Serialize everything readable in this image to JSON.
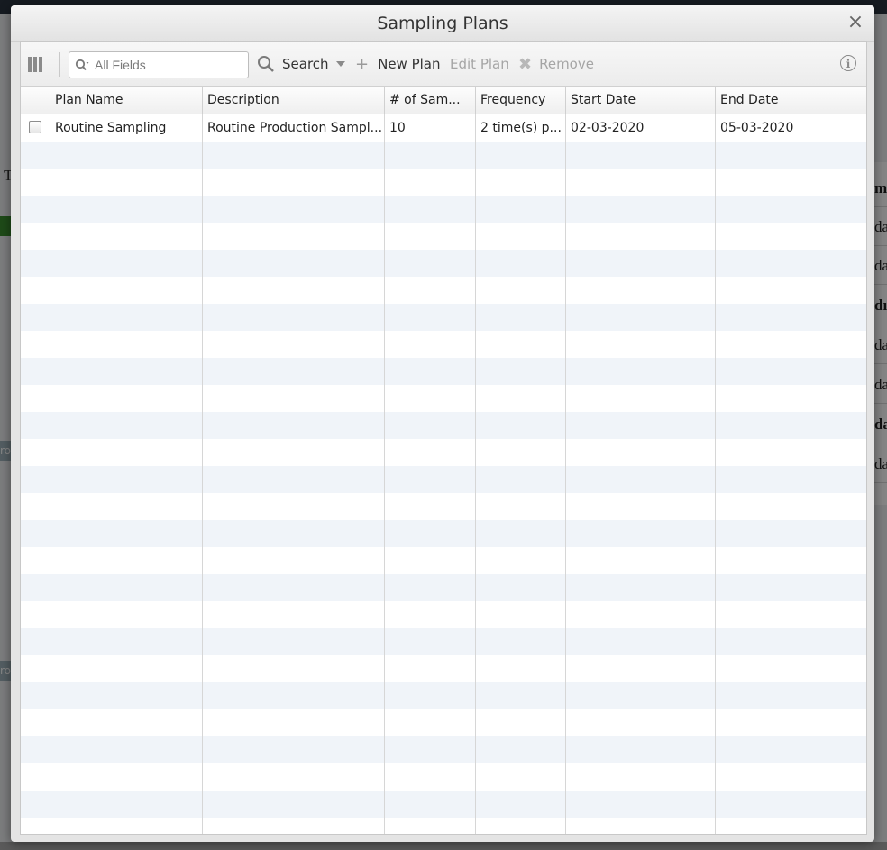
{
  "background": {
    "left_letter": "T",
    "left_chips": [
      "ro",
      "ro"
    ],
    "right_cells": [
      "m",
      "da",
      "da",
      "dı",
      "da",
      "da",
      "da",
      "da"
    ]
  },
  "dialog": {
    "title": "Sampling Plans",
    "close_glyph": "×",
    "toolbar": {
      "search_placeholder": "All Fields",
      "search_label": "Search",
      "new_plan_label": "New Plan",
      "edit_plan_label": "Edit Plan",
      "remove_label": "Remove",
      "info_glyph": "i"
    },
    "table": {
      "columns": [
        "Plan Name",
        "Description",
        "# of Sam...",
        "Frequency",
        "Start Date",
        "End Date"
      ],
      "rows": [
        {
          "plan_name": "Routine Sampling",
          "description": "Routine Production Sampl...",
          "num_samples": "10",
          "frequency": "2 time(s) p...",
          "start_date": "02-03-2020",
          "end_date": "05-03-2020"
        }
      ]
    }
  },
  "colors": {
    "header_bg": "#eaeaea",
    "row_alt": "#f0f4f9",
    "disabled_text": "#a5a5a5"
  }
}
